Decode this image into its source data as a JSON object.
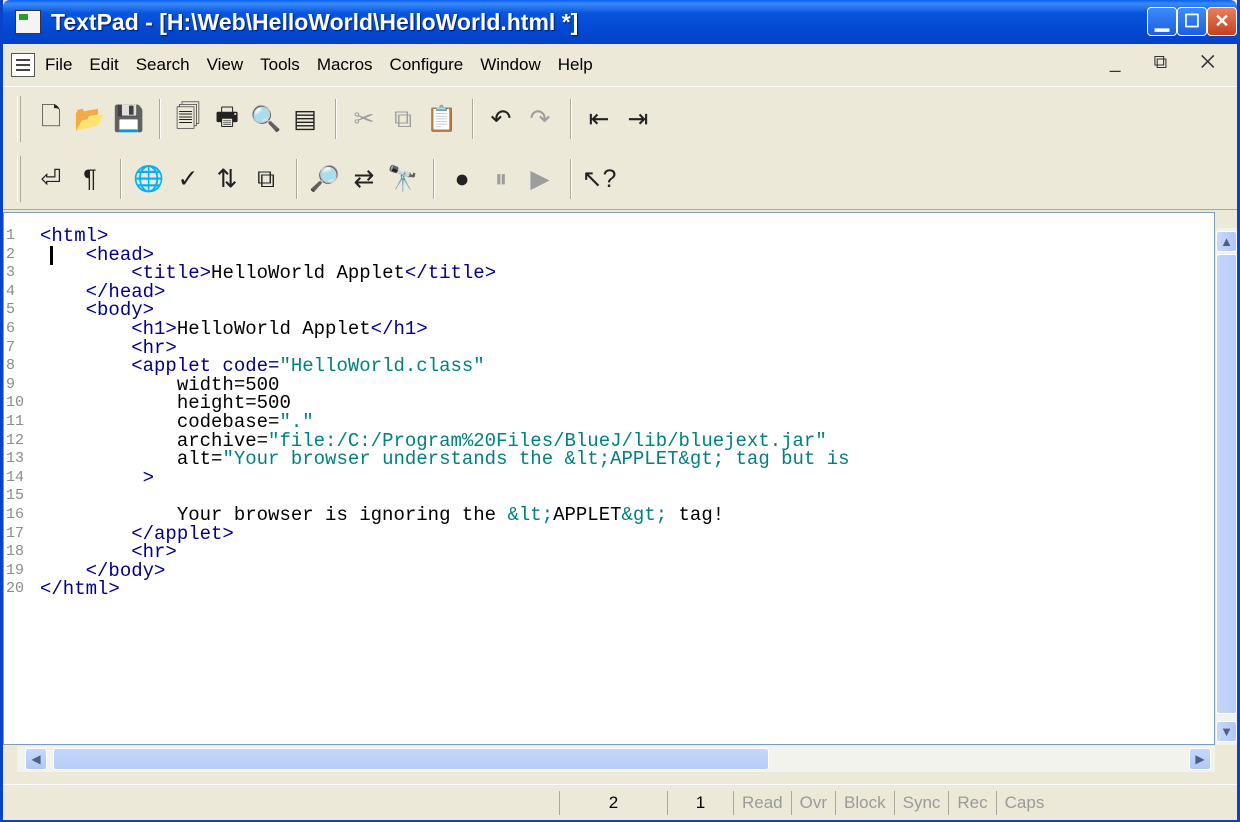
{
  "window": {
    "title": "TextPad - [H:\\Web\\HelloWorld\\HelloWorld.html *]"
  },
  "menu": [
    "File",
    "Edit",
    "Search",
    "View",
    "Tools",
    "Macros",
    "Configure",
    "Window",
    "Help"
  ],
  "toolbar1": [
    {
      "name": "new-file",
      "glyph": "🗋"
    },
    {
      "name": "open-file",
      "glyph": "📂"
    },
    {
      "name": "save-file",
      "glyph": "💾"
    },
    {
      "sep": true
    },
    {
      "name": "manage-files",
      "glyph": "🗐"
    },
    {
      "name": "print",
      "glyph": "🖶"
    },
    {
      "name": "print-preview",
      "glyph": "🔍"
    },
    {
      "name": "document-properties",
      "glyph": "▤"
    },
    {
      "sep": true
    },
    {
      "name": "cut",
      "glyph": "✂",
      "dim": true
    },
    {
      "name": "copy",
      "glyph": "⧉",
      "dim": true
    },
    {
      "name": "paste",
      "glyph": "📋"
    },
    {
      "sep": true
    },
    {
      "name": "undo",
      "glyph": "↶"
    },
    {
      "name": "redo",
      "glyph": "↷",
      "dim": true
    },
    {
      "sep": true
    },
    {
      "name": "decrease-indent",
      "glyph": "⇤"
    },
    {
      "name": "increase-indent",
      "glyph": "⇥"
    }
  ],
  "toolbar2": [
    {
      "name": "word-wrap",
      "glyph": "⏎"
    },
    {
      "name": "visible-spaces",
      "glyph": "¶"
    },
    {
      "sep": true
    },
    {
      "name": "web-browser",
      "glyph": "🌐"
    },
    {
      "name": "spell-check",
      "glyph": "✓"
    },
    {
      "name": "sort",
      "glyph": "⇅"
    },
    {
      "name": "compare-files",
      "glyph": "⧉"
    },
    {
      "sep": true
    },
    {
      "name": "find",
      "glyph": "🔎"
    },
    {
      "name": "find-replace",
      "glyph": "⇄"
    },
    {
      "name": "find-in-files",
      "glyph": "🔭"
    },
    {
      "sep": true
    },
    {
      "name": "record-macro",
      "glyph": "●"
    },
    {
      "name": "pause-macro",
      "glyph": "⏸",
      "dim": true
    },
    {
      "name": "playback-macro",
      "glyph": "▶",
      "dim": true
    },
    {
      "sep": true
    },
    {
      "name": "help-pointer",
      "glyph": "↖?"
    }
  ],
  "code_lines": [
    [
      [
        "tag",
        "<html>"
      ]
    ],
    [
      [
        "txt",
        "    "
      ],
      [
        "tag",
        "<head>"
      ]
    ],
    [
      [
        "txt",
        "        "
      ],
      [
        "tag",
        "<title>"
      ],
      [
        "txt",
        "HelloWorld Applet"
      ],
      [
        "tag",
        "</title>"
      ]
    ],
    [
      [
        "txt",
        "    "
      ],
      [
        "tag",
        "</head>"
      ]
    ],
    [
      [
        "txt",
        "    "
      ],
      [
        "tag",
        "<body>"
      ]
    ],
    [
      [
        "txt",
        "        "
      ],
      [
        "tag",
        "<h1>"
      ],
      [
        "txt",
        "HelloWorld Applet"
      ],
      [
        "tag",
        "</h1>"
      ]
    ],
    [
      [
        "txt",
        "        "
      ],
      [
        "tag",
        "<hr>"
      ]
    ],
    [
      [
        "txt",
        "        "
      ],
      [
        "tag",
        "<applet code="
      ],
      [
        "str",
        "\"HelloWorld.class\""
      ]
    ],
    [
      [
        "txt",
        "            width=500"
      ]
    ],
    [
      [
        "txt",
        "            height=500"
      ]
    ],
    [
      [
        "txt",
        "            codebase="
      ],
      [
        "str",
        "\".\""
      ]
    ],
    [
      [
        "txt",
        "            archive="
      ],
      [
        "str",
        "\"file:/C:/Program%20Files/BlueJ/lib/bluejext.jar\""
      ]
    ],
    [
      [
        "txt",
        "            alt="
      ],
      [
        "str",
        "\"Your browser understands the &lt;APPLET&gt; tag but is"
      ]
    ],
    [
      [
        "txt",
        "         "
      ],
      [
        "tag",
        ">"
      ]
    ],
    [],
    [
      [
        "txt",
        "            Your browser is ignoring the "
      ],
      [
        "ent",
        "&lt;"
      ],
      [
        "txt",
        "APPLET"
      ],
      [
        "ent",
        "&gt;"
      ],
      [
        "txt",
        " tag!"
      ]
    ],
    [
      [
        "txt",
        "        "
      ],
      [
        "tag",
        "</applet>"
      ]
    ],
    [
      [
        "txt",
        "        "
      ],
      [
        "tag",
        "<hr>"
      ]
    ],
    [
      [
        "txt",
        "    "
      ],
      [
        "tag",
        "</body>"
      ]
    ],
    [
      [
        "tag",
        "</html>"
      ]
    ]
  ],
  "status": {
    "line": "2",
    "col": "1",
    "indicators": [
      "Read",
      "Ovr",
      "Block",
      "Sync",
      "Rec",
      "Caps"
    ]
  }
}
